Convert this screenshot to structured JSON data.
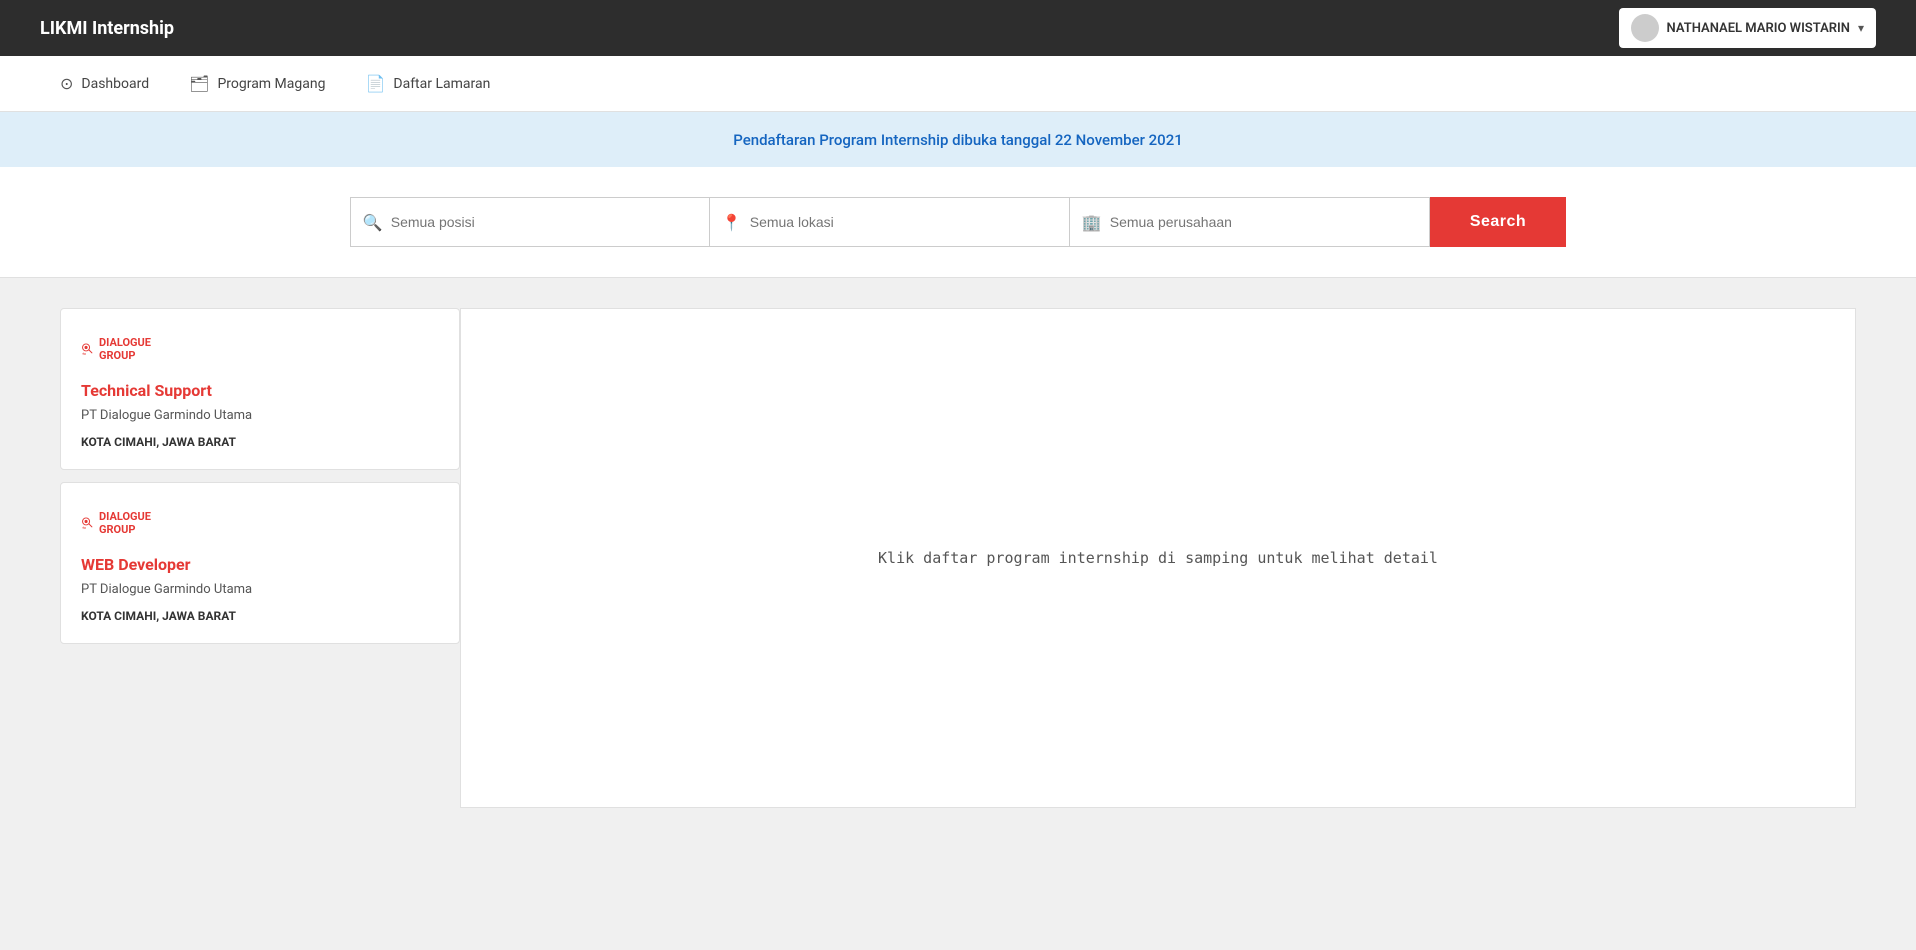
{
  "brand": {
    "text_plain": "LIKMI ",
    "text_bold": "Internship"
  },
  "user": {
    "name": "NATHANAEL MARIO WISTARIN",
    "avatar_alt": "user avatar"
  },
  "secondary_nav": {
    "items": [
      {
        "id": "dashboard",
        "label": "Dashboard",
        "icon": "compass"
      },
      {
        "id": "program-magang",
        "label": "Program Magang",
        "icon": "briefcase"
      },
      {
        "id": "daftar-lamaran",
        "label": "Daftar Lamaran",
        "icon": "file"
      }
    ]
  },
  "banner": {
    "text": "Pendaftaran Program Internship dibuka tanggal 22 November 2021"
  },
  "search": {
    "position_placeholder": "Semua posisi",
    "location_placeholder": "Semua lokasi",
    "company_placeholder": "Semua perusahaan",
    "button_label": "Search"
  },
  "jobs": [
    {
      "id": "job-1",
      "company_logo": "DIALOGUE GROUP",
      "title": "Technical Support",
      "company": "PT Dialogue Garmindo Utama",
      "location": "KOTA CIMAHI, JAWA BARAT"
    },
    {
      "id": "job-2",
      "company_logo": "DIALOGUE GROUP",
      "title": "WEB Developer",
      "company": "PT Dialogue Garmindo Utama",
      "location": "KOTA CIMAHI, JAWA BARAT"
    }
  ],
  "detail_placeholder": "Klik daftar program internship di samping untuk melihat detail"
}
